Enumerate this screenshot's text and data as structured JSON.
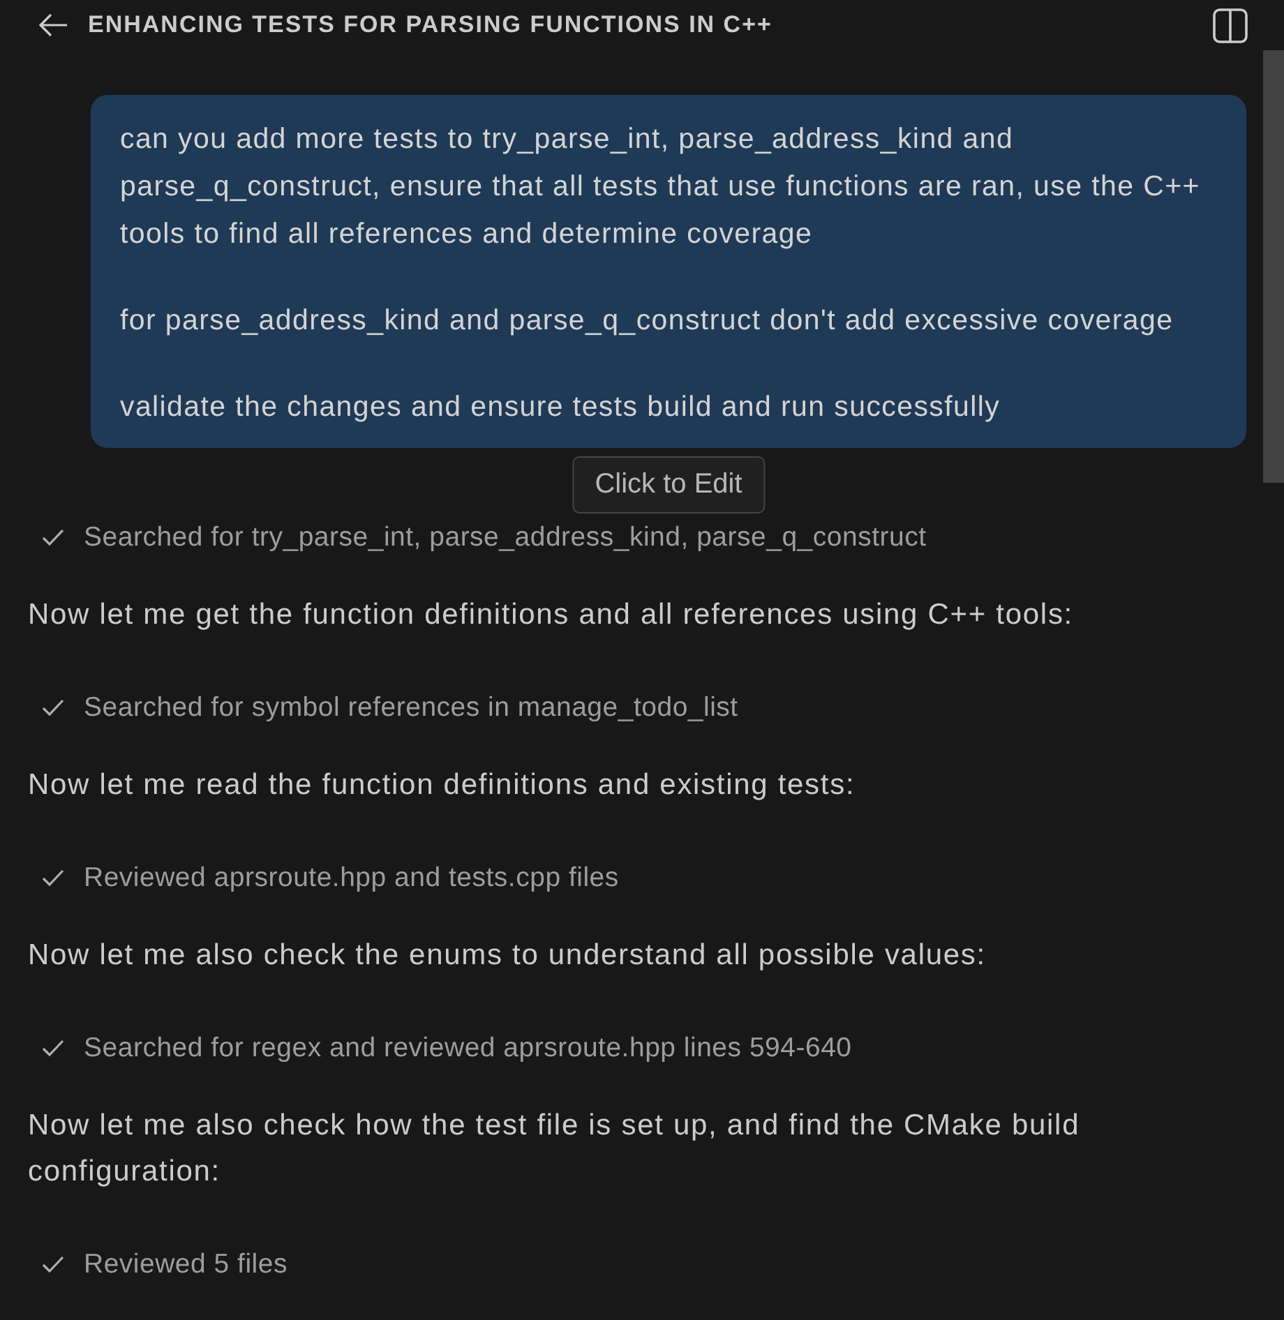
{
  "header": {
    "title": "ENHANCING TESTS FOR PARSING FUNCTIONS IN C++"
  },
  "user_message": {
    "paragraphs": [
      "can you add more tests to try_parse_int, parse_address_kind and parse_q_construct, ensure that all tests that use functions are ran, use the C++ tools to find all references and determine coverage",
      "for parse_address_kind and parse_q_construct don't add excessive coverage",
      "validate the changes and ensure tests build and run successfully"
    ],
    "tooltip": "Click to Edit"
  },
  "transcript": [
    {
      "kind": "step",
      "text": "Searched for try_parse_int, parse_address_kind, parse_q_construct"
    },
    {
      "kind": "text",
      "text": "Now let me get the function definitions and all references using C++ tools:"
    },
    {
      "kind": "step",
      "text": "Searched for symbol references in manage_todo_list"
    },
    {
      "kind": "text",
      "text": "Now let me read the function definitions and existing tests:"
    },
    {
      "kind": "step",
      "text": "Reviewed aprsroute.hpp and tests.cpp files"
    },
    {
      "kind": "text",
      "text": "Now let me also check the enums to understand all possible values:"
    },
    {
      "kind": "step",
      "text": "Searched for regex and reviewed aprsroute.hpp lines 594-640"
    },
    {
      "kind": "text",
      "text": "Now let me also check how the test file is set up, and find the CMake build configuration:"
    },
    {
      "kind": "step",
      "text": "Reviewed 5 files"
    }
  ]
}
